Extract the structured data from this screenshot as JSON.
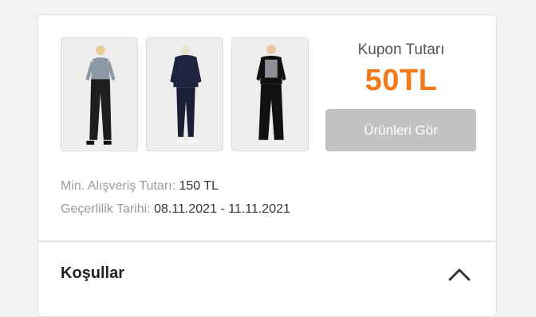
{
  "products": [
    {
      "name": "product-image-1"
    },
    {
      "name": "product-image-2"
    },
    {
      "name": "product-image-3"
    }
  ],
  "coupon": {
    "label": "Kupon Tutarı",
    "amount": "50TL",
    "button_label": "Ürünleri Gör"
  },
  "info": {
    "min_label": "Min. Alışveriş Tutarı:",
    "min_value": "150 TL",
    "validity_label": "Geçerlilik Tarihi:",
    "validity_value": "08.11.2021 - 11.11.2021"
  },
  "terms": {
    "title": "Koşullar",
    "icon": "chevron-up-icon"
  },
  "colors": {
    "accent": "#f27a1a",
    "button_bg": "#c2c2c2"
  }
}
